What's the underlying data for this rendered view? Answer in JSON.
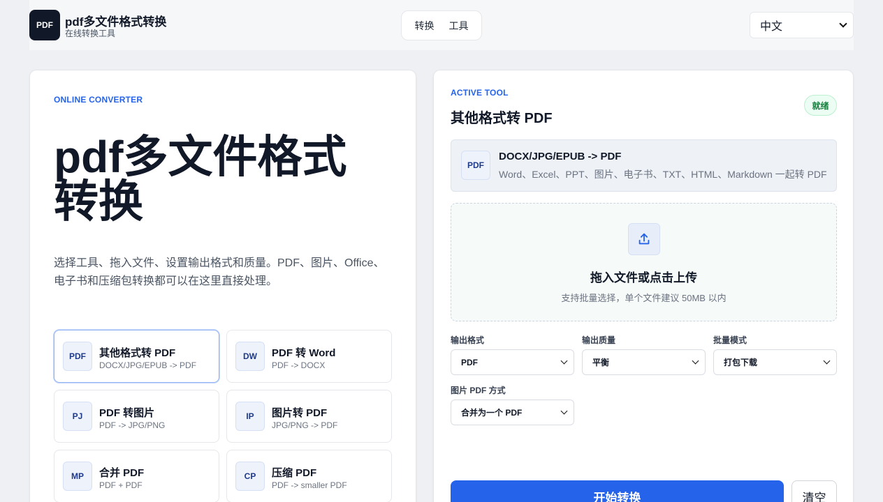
{
  "header": {
    "logo_text": "PDF",
    "title": "pdf多文件格式转换",
    "subtitle": "在线转换工具",
    "nav": [
      "转换",
      "工具"
    ],
    "language": "中文"
  },
  "left": {
    "eyebrow": "ONLINE CONVERTER",
    "title": "pdf多文件格式转换",
    "description": "选择工具、拖入文件、设置输出格式和质量。PDF、图片、Office、电子书和压缩包转换都可以在这里直接处理。",
    "tools": [
      {
        "badge": "PDF",
        "title": "其他格式转 PDF",
        "sub": "DOCX/JPG/EPUB -> PDF"
      },
      {
        "badge": "DW",
        "title": "PDF 转 Word",
        "sub": "PDF -> DOCX"
      },
      {
        "badge": "PJ",
        "title": "PDF 转图片",
        "sub": "PDF -> JPG/PNG"
      },
      {
        "badge": "IP",
        "title": "图片转 PDF",
        "sub": "JPG/PNG -> PDF"
      },
      {
        "badge": "MP",
        "title": "合并 PDF",
        "sub": "PDF + PDF"
      },
      {
        "badge": "CP",
        "title": "压缩 PDF",
        "sub": "PDF -> smaller PDF"
      }
    ]
  },
  "right": {
    "eyebrow": "ACTIVE TOOL",
    "title": "其他格式转 PDF",
    "status": "就绪",
    "selected": {
      "badge": "PDF",
      "title": "DOCX/JPG/EPUB -> PDF",
      "sub": "Word、Excel、PPT、图片、电子书、TXT、HTML、Markdown 一起转 PDF"
    },
    "dropzone": {
      "title": "拖入文件或点击上传",
      "sub": "支持批量选择，单个文件建议 50MB 以内"
    },
    "fields": {
      "format_label": "输出格式",
      "format_value": "PDF",
      "quality_label": "输出质量",
      "quality_value": "平衡",
      "batch_label": "批量模式",
      "batch_value": "打包下载",
      "image_label": "图片 PDF 方式",
      "image_value": "合并为一个 PDF"
    },
    "start_label": "开始转换",
    "clear_label": "清空"
  },
  "colors": {
    "accent": "#2563eb",
    "status_green": "#15803d"
  }
}
